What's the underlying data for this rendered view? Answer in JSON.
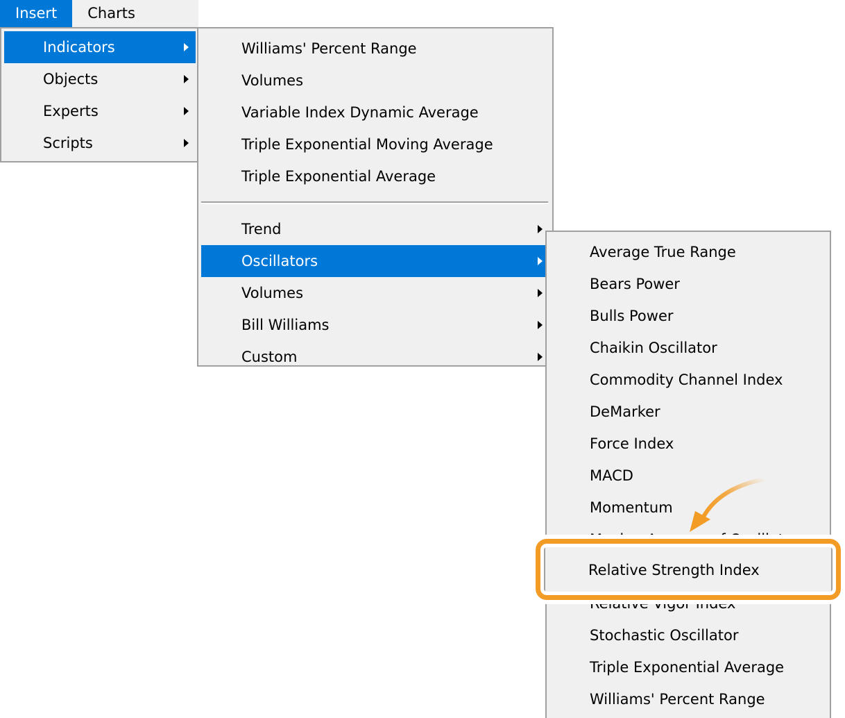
{
  "menubar": {
    "items": [
      {
        "label": "Insert",
        "active": true
      },
      {
        "label": "Charts",
        "active": false
      }
    ]
  },
  "insert_menu": {
    "items": [
      {
        "label": "Indicators",
        "submenu": true,
        "selected": true
      },
      {
        "label": "Objects",
        "submenu": true,
        "selected": false
      },
      {
        "label": "Experts",
        "submenu": true,
        "selected": false
      },
      {
        "label": "Scripts",
        "submenu": true,
        "selected": false
      }
    ]
  },
  "indicators_menu": {
    "recent_items": [
      {
        "label": "Williams' Percent Range"
      },
      {
        "label": "Volumes"
      },
      {
        "label": "Variable Index Dynamic Average"
      },
      {
        "label": "Triple Exponential Moving Average"
      },
      {
        "label": "Triple Exponential Average"
      }
    ],
    "category_items": [
      {
        "label": "Trend",
        "submenu": true,
        "selected": false
      },
      {
        "label": "Oscillators",
        "submenu": true,
        "selected": true
      },
      {
        "label": "Volumes",
        "submenu": true,
        "selected": false
      },
      {
        "label": "Bill Williams",
        "submenu": true,
        "selected": false
      },
      {
        "label": "Custom",
        "submenu": true,
        "selected": false
      }
    ]
  },
  "oscillators_menu": {
    "items": [
      {
        "label": "Average True Range"
      },
      {
        "label": "Bears Power"
      },
      {
        "label": "Bulls Power"
      },
      {
        "label": "Chaikin Oscillator"
      },
      {
        "label": "Commodity Channel Index"
      },
      {
        "label": "DeMarker"
      },
      {
        "label": "Force Index"
      },
      {
        "label": "MACD"
      },
      {
        "label": "Momentum"
      },
      {
        "label": "Moving Average of Oscillator"
      },
      {
        "label": "Relative Strength Index"
      },
      {
        "label": "Relative Vigor Index"
      },
      {
        "label": "Stochastic Oscillator"
      },
      {
        "label": "Triple Exponential Average"
      },
      {
        "label": "Williams' Percent Range"
      }
    ],
    "highlighted_label": "Relative Strength Index"
  },
  "colors": {
    "accent": "#0078d7",
    "menu_bg": "#f0f0f0",
    "annotation": "#f39c25"
  }
}
